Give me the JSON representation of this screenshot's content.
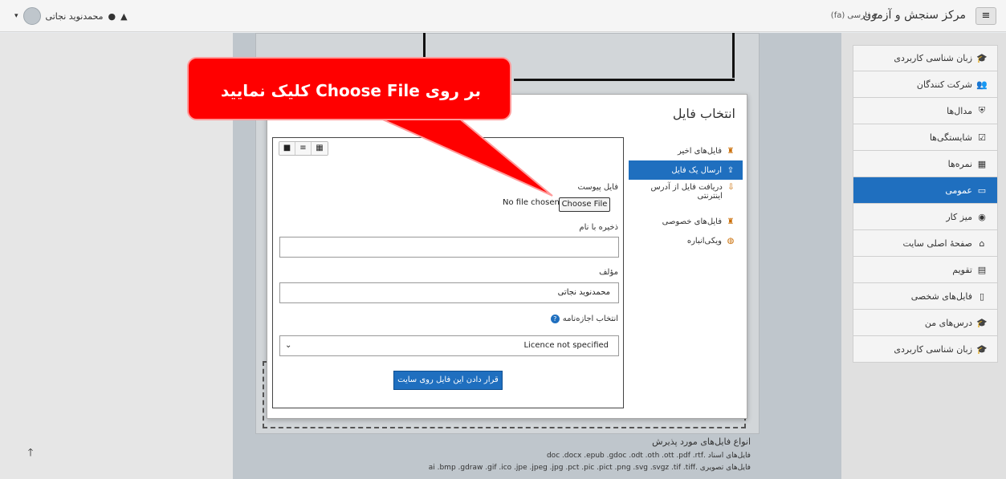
{
  "navbar": {
    "site_title": "مرکز سنجش و آزمون",
    "language": "فارسی (fa)",
    "user_name": "محمدنوید نجاتی",
    "icons": [
      "menu-icon",
      "bell-icon",
      "chat-icon",
      "caret-down-icon"
    ]
  },
  "drawer": {
    "items": [
      {
        "label": "زبان شناسی کاربردی",
        "icon": "graduation-cap-icon"
      },
      {
        "label": "شرکت کنندگان",
        "icon": "users-icon"
      },
      {
        "label": "مدال‌ها",
        "icon": "shield-icon"
      },
      {
        "label": "شایستگی‌ها",
        "icon": "checkbox-icon"
      },
      {
        "label": "نمره‌ها",
        "icon": "table-icon"
      },
      {
        "label": "عمومی",
        "icon": "folder-icon",
        "active": true
      },
      {
        "label": "میز کار",
        "icon": "dashboard-icon"
      },
      {
        "label": "صفحهٔ اصلی سایت",
        "icon": "home-icon"
      },
      {
        "label": "تقویم",
        "icon": "calendar-icon"
      },
      {
        "label": "فایل‌های شخصی",
        "icon": "file-icon"
      },
      {
        "label": "درس‌های من",
        "icon": "graduation-cap-icon"
      },
      {
        "label": "زبان شناسی کاربردی",
        "icon": "graduation-cap-icon"
      }
    ]
  },
  "background": {
    "accepted_title": "انواع فایل‌های مورد پذیرش",
    "documents_line": "فایل‌های اسناد .doc .docx .epub .gdoc .odt .oth .ott .pdf .rtf",
    "images_line": "فایل‌های تصویری .ai .bmp .gdraw .gif .ico .jpe .jpeg .jpg .pct .pic .pict .png .svg .svgz .tif .tiff"
  },
  "modal": {
    "title": "انتخاب فایل",
    "repositories": [
      {
        "label": "فایل‌های اخیر",
        "icon": "recent-files-icon"
      },
      {
        "label": "ارسال یک فایل",
        "icon": "upload-icon",
        "active": true
      },
      {
        "label": "دریافت فایل از آدرس اینترنتی",
        "icon": "url-download-icon"
      },
      {
        "label": "فایل‌های خصوصی",
        "icon": "private-files-icon"
      },
      {
        "label": "ویکی‌انباره",
        "icon": "wikimedia-icon"
      }
    ],
    "attachment_label": "فایل پیوست",
    "no_file_text": "No file chosen",
    "choose_file_label": "Choose File",
    "save_as_label": "ذخیره با نام",
    "save_as_value": "",
    "author_label": "مؤلف",
    "author_value": "محمدنوید نجاتی",
    "license_label": "انتخاب اجازه‌نامه",
    "license_selected": "Licence not specified",
    "upload_button": "قرار دادن این فایل روی سایت"
  },
  "callout": {
    "text": "بر روی Choose File کلیک نمایید",
    "color": "#ff0000"
  },
  "colors": {
    "accent": "#1f6fbf",
    "callout": "#ff0000"
  }
}
